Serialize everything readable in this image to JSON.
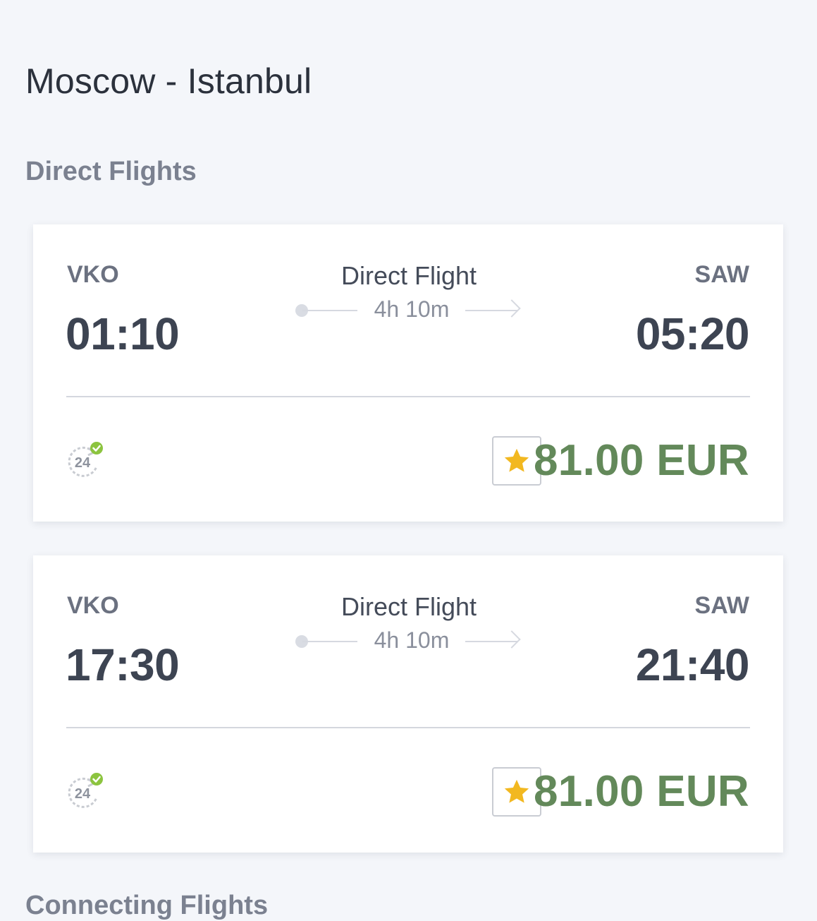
{
  "route_title": "Moscow - Istanbul",
  "sections": {
    "direct": "Direct Flights",
    "connecting": "Connecting Flights"
  },
  "flights": [
    {
      "from_code": "VKO",
      "to_code": "SAW",
      "departure": "01:10",
      "arrival": "05:20",
      "type": "Direct Flight",
      "duration": "4h 10m",
      "badge": "24",
      "price": "81.00 EUR"
    },
    {
      "from_code": "VKO",
      "to_code": "SAW",
      "departure": "17:30",
      "arrival": "21:40",
      "type": "Direct Flight",
      "duration": "4h 10m",
      "badge": "24",
      "price": "81.00 EUR"
    }
  ],
  "colors": {
    "price": "#63895a",
    "star": "#f2b820",
    "check": "#8cc43f",
    "background": "#f4f6fa"
  },
  "icons": {
    "support": "support-24h-icon",
    "favorite": "star-icon",
    "connector": "flight-arrow-icon"
  }
}
